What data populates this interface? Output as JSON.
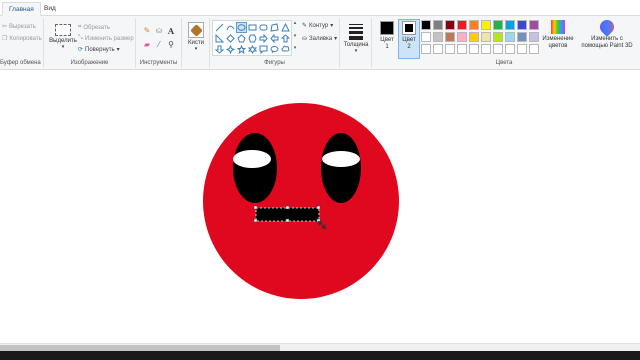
{
  "tabs": [
    {
      "label": "Главная",
      "active": true
    },
    {
      "label": "Вид",
      "active": false
    }
  ],
  "clipboard": {
    "cut": "Вырезать",
    "copy": "Копировать",
    "group_label": "Буфер обмена"
  },
  "image": {
    "select": "Выделить",
    "crop": "Обрезать",
    "resize": "Изменить размер",
    "rotate": "Повернуть",
    "group_label": "Изображение"
  },
  "tools": {
    "group_label": "Инструменты",
    "items": [
      "pencil-icon",
      "fill-icon",
      "text-icon",
      "eraser-icon",
      "color-picker-icon",
      "magnifier-icon"
    ]
  },
  "brushes": {
    "label": "Кисти"
  },
  "shapes": {
    "group_label": "Фигуры",
    "outline": "Контур",
    "fill": "Заливка",
    "items": [
      "line",
      "curve",
      "oval",
      "rectangle",
      "rounded-rectangle",
      "polygon",
      "triangle",
      "right-triangle",
      "diamond",
      "pentagon",
      "hexagon",
      "right-arrow",
      "left-arrow",
      "up-arrow",
      "down-arrow",
      "four-point-star",
      "five-point-star",
      "six-point-star",
      "rounded-callout",
      "oval-callout",
      "cloud-callout",
      "heart",
      "lightning"
    ],
    "selected": "oval"
  },
  "size": {
    "label": "Толщина"
  },
  "colors": {
    "group_label": "Цвета",
    "color1_label": "Цвет 1",
    "color2_label": "Цвет 2",
    "color1": "#000000",
    "color2": "#000000",
    "edit_colors": "Изменение цветов",
    "paint3d": "Изменить с помощью Paint 3D",
    "palette": [
      "#000000",
      "#7f7f7f",
      "#880015",
      "#ed1c24",
      "#ff7f27",
      "#fff200",
      "#22b14c",
      "#00a2e8",
      "#3f48cc",
      "#a349a4",
      "#ffffff",
      "#c3c3c3",
      "#b97a57",
      "#ffaec9",
      "#ffc90e",
      "#efe4b0",
      "#b5e61d",
      "#99d9ea",
      "#7092be",
      "#c8bfe7",
      "#ffffff",
      "#ffffff",
      "#ffffff",
      "#ffffff",
      "#ffffff",
      "#ffffff",
      "#ffffff",
      "#ffffff",
      "#ffffff",
      "#ffffff"
    ]
  },
  "drawing": {
    "face_color": "#e0081f",
    "eye_color": "#000000",
    "eye_white": "#ffffff",
    "mouth_color": "#000000"
  }
}
